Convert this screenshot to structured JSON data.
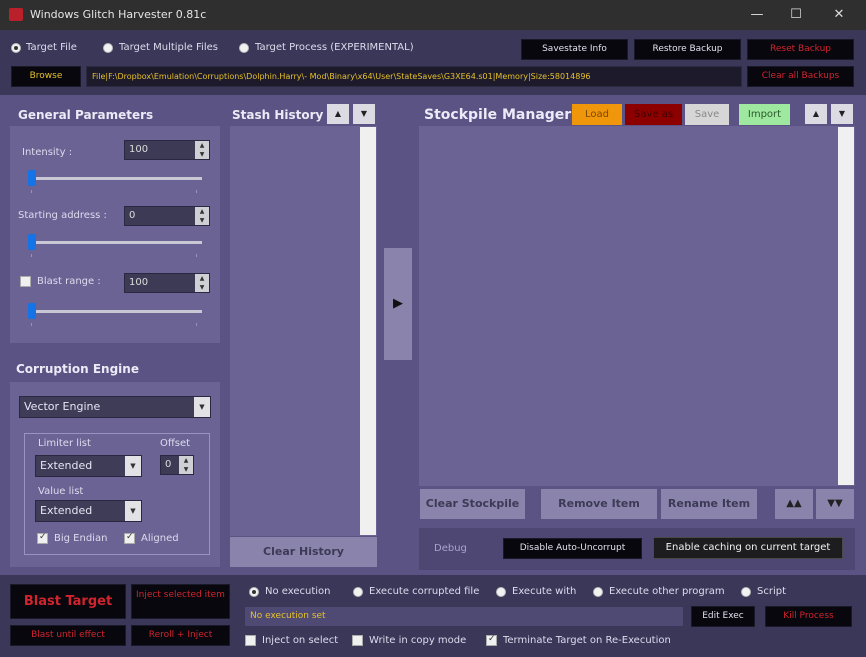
{
  "window": {
    "title": "Windows Glitch Harvester 0.81c",
    "minimize_glyph": "—",
    "maximize_glyph": "☐",
    "close_glyph": "✕"
  },
  "target": {
    "file_label": "Target File",
    "multiple_label": "Target Multiple Files",
    "process_label": "Target Process (EXPERIMENTAL)",
    "browse_label": "Browse",
    "path": "File|F:\\Dropbox\\Emulation\\Corruptions\\Dolphin.Harry\\- Mod\\Binary\\x64\\User\\StateSaves\\G3XE64.s01|Memory|Size:58014896"
  },
  "top_buttons": {
    "savestate": "Savestate Info",
    "restore": "Restore Backup",
    "reset": "Reset Backup",
    "clear_all": "Clear all Backups"
  },
  "general": {
    "heading": "General Parameters",
    "intensity_label": "Intensity :",
    "intensity_value": "100",
    "start_label": "Starting address :",
    "start_value": "0",
    "blast_label": "Blast range :",
    "blast_value": "100"
  },
  "engine": {
    "heading": "Corruption Engine",
    "selected": "Vector Engine",
    "limiter_label": "Limiter list",
    "limiter_value": "Extended",
    "offset_label": "Offset",
    "offset_value": "0",
    "value_label": "Value list",
    "value_value": "Extended",
    "big_endian": "Big Endian",
    "aligned": "Aligned"
  },
  "stash": {
    "heading": "Stash History",
    "clear": "Clear History"
  },
  "stockpile": {
    "heading": "Stockpile Manager",
    "load": "Load",
    "save_as": "Save as",
    "save": "Save",
    "import": "Import",
    "clear": "Clear Stockpile",
    "remove": "Remove Item",
    "rename": "Rename Item",
    "up2": "▲▲",
    "down2": "▼▼"
  },
  "debug": {
    "label": "Debug",
    "disable_auto": "Disable Auto-Uncorrupt",
    "tooltip": "Enable caching on current target"
  },
  "bottom": {
    "blast": "Blast Target",
    "inject": "Inject selected item",
    "blast_effect": "Blast until effect",
    "rerolls": "Reroll + Inject",
    "no_exec": "No execution",
    "exec_corrupted": "Execute corrupted file",
    "exec_with": "Execute with",
    "exec_other": "Execute other program",
    "script": "Script",
    "exec_value": "No execution set",
    "edit_exec": "Edit Exec",
    "kill_process": "Kill Process",
    "inject_on_select": "Inject on select",
    "write_copy": "Write in copy mode",
    "terminate": "Terminate Target on Re-Execution"
  },
  "colors": {
    "background": "#3b3759",
    "panel": "#6a6394",
    "accent_blue": "#1473e6",
    "load_orange": "#f0960a",
    "saveas_red": "#8c0000",
    "import_green": "#9fe8a0",
    "path_text": "#e6c12a"
  }
}
